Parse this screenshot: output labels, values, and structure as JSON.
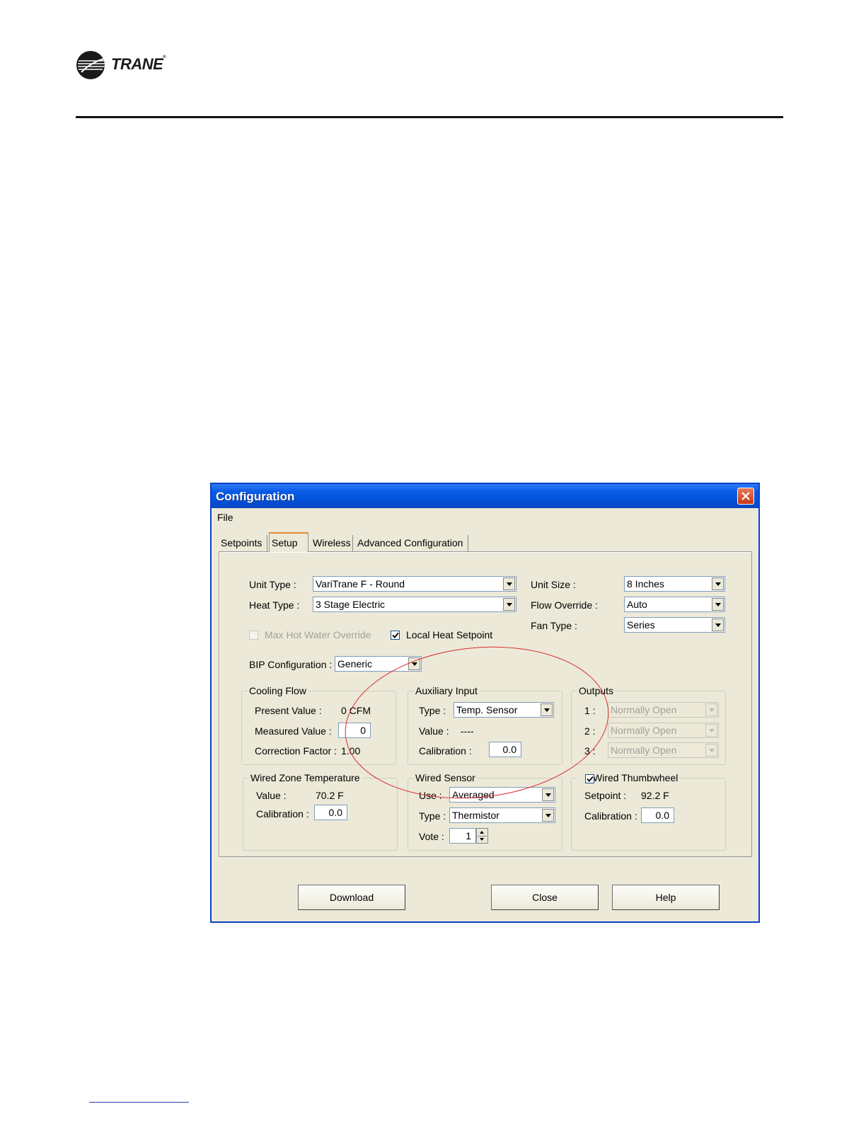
{
  "brand": {
    "name": "TRANE",
    "mark": "®"
  },
  "window": {
    "title": "Configuration",
    "menu": {
      "file": "File"
    },
    "tabs": [
      "Setpoints",
      "Setup",
      "Wireless",
      "Advanced Configuration"
    ],
    "active_tab": "Setup"
  },
  "setup": {
    "unit_type_label": "Unit Type :",
    "unit_type_value": "VariTrane F - Round",
    "heat_type_label": "Heat Type :",
    "heat_type_value": "3 Stage Electric",
    "unit_size_label": "Unit Size :",
    "unit_size_value": "8 Inches",
    "flow_override_label": "Flow Override :",
    "flow_override_value": "Auto",
    "fan_type_label": "Fan Type :",
    "fan_type_value": "Series",
    "max_hot_water_override_label": "Max Hot Water Override",
    "local_heat_setpoint_label": "Local Heat Setpoint",
    "bip_config_label": "BIP Configuration :",
    "bip_config_value": "Generic"
  },
  "cooling_flow": {
    "title": "Cooling Flow",
    "present_value_label": "Present Value :",
    "present_value": "0 CFM",
    "measured_value_label": "Measured Value :",
    "measured_value": "0",
    "correction_factor_label": "Correction Factor :",
    "correction_factor": "1.00"
  },
  "auxiliary_input": {
    "title": "Auxiliary Input",
    "type_label": "Type :",
    "type_value": "Temp. Sensor",
    "value_label": "Value :",
    "value": "----",
    "calibration_label": "Calibration :",
    "calibration_value": "0.0"
  },
  "outputs": {
    "title": "Outputs",
    "items": [
      {
        "label": "1 :",
        "value": "Normally Open"
      },
      {
        "label": "2 :",
        "value": "Normally Open"
      },
      {
        "label": "3 :",
        "value": "Normally Open"
      }
    ]
  },
  "wired_zone_temperature": {
    "title": "Wired Zone Temperature",
    "value_label": "Value :",
    "value": "70.2 F",
    "calibration_label": "Calibration :",
    "calibration_value": "0.0"
  },
  "wired_sensor": {
    "title": "Wired Sensor",
    "use_label": "Use :",
    "use_value": "Averaged",
    "type_label": "Type :",
    "type_value": "Thermistor",
    "vote_label": "Vote :",
    "vote_value": "1"
  },
  "wired_thumbwheel": {
    "title": "Wired Thumbwheel",
    "setpoint_label": "Setpoint :",
    "setpoint_value": "92.2 F",
    "calibration_label": "Calibration :",
    "calibration_value": "0.0"
  },
  "buttons": {
    "download": "Download",
    "close": "Close",
    "help": "Help"
  },
  "colors": {
    "titlebar": "#0a5be7",
    "highlight_circle": "#d82b2b",
    "dialog_bg": "#ece9d8"
  }
}
